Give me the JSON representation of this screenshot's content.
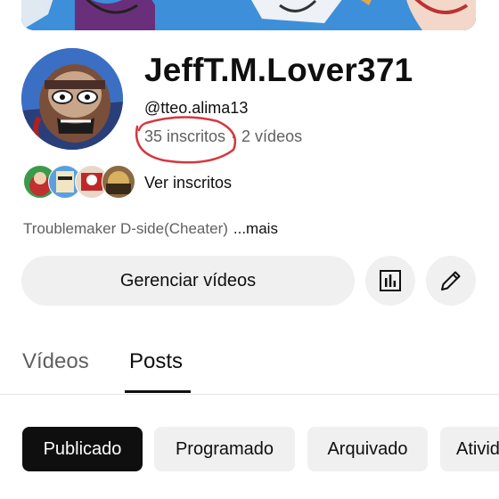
{
  "channel": {
    "name": "JeffT.M.Lover371",
    "handle": "@tteo.alima13",
    "subscribers": "35 inscritos",
    "separator": "·",
    "videos": "2 vídeos",
    "view_subscribers": "Ver inscritos",
    "description": "Troublemaker D-side(Cheater)",
    "more": "...mais"
  },
  "actions": {
    "manage_videos": "Gerenciar vídeos",
    "analytics_icon": "bar-chart-icon",
    "edit_icon": "pencil-icon"
  },
  "tabs": [
    {
      "label": "Vídeos",
      "active": false
    },
    {
      "label": "Posts",
      "active": true
    }
  ],
  "chips": [
    {
      "label": "Publicado",
      "active": true
    },
    {
      "label": "Programado",
      "active": false
    },
    {
      "label": "Arquivado",
      "active": false
    },
    {
      "label": "Ativid",
      "active": false
    }
  ],
  "colors": {
    "annotation": "#d6373f",
    "chip_active": "#0f0f0f",
    "chip_bg": "#f0f0f0"
  }
}
